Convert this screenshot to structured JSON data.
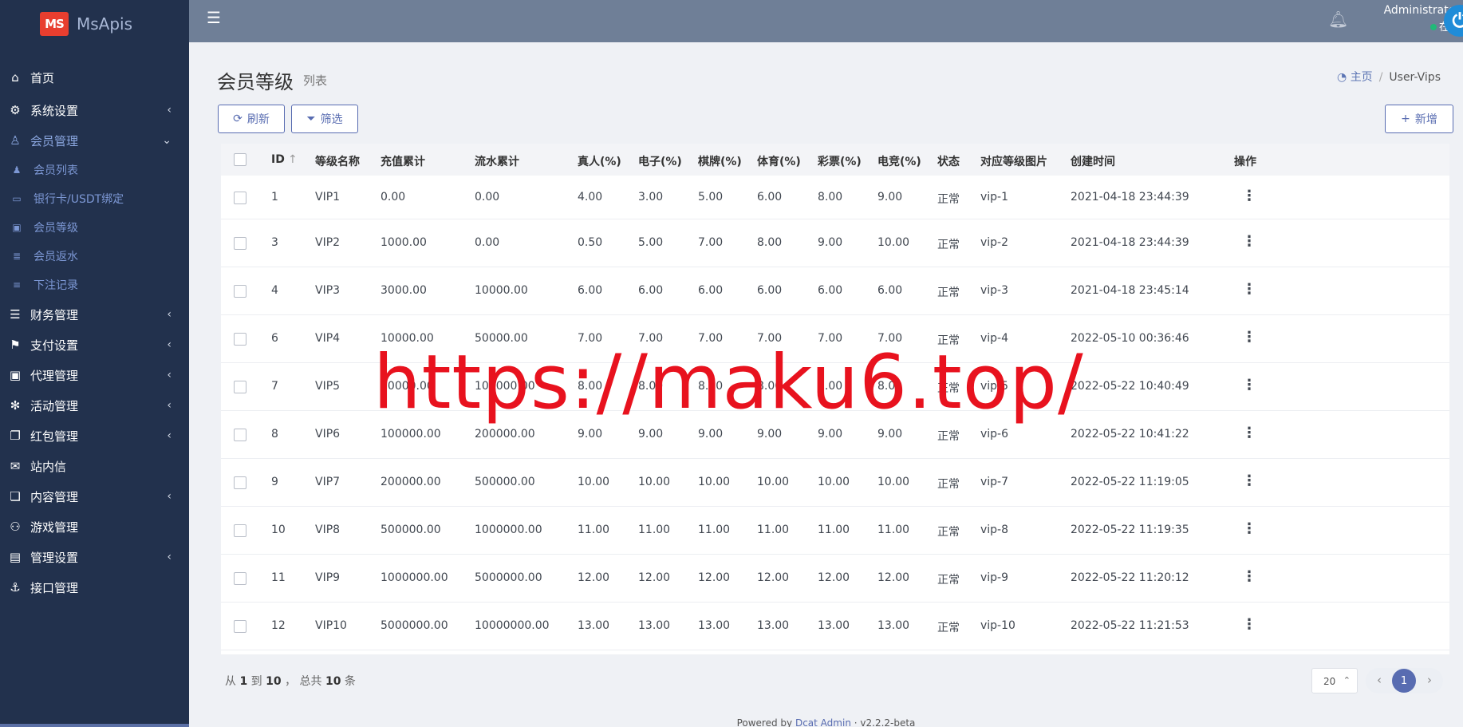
{
  "brand": {
    "logo_text": "MS",
    "name": "MsApis"
  },
  "sidebar": {
    "items": [
      {
        "icon": "home-icon",
        "glyph": "⌂",
        "label": "首页",
        "arrow": ""
      },
      {
        "icon": "gears-icon",
        "glyph": "⚙",
        "label": "系统设置",
        "arrow": "‹"
      },
      {
        "icon": "user-icon",
        "glyph": "♙",
        "label": "会员管理",
        "arrow": "⌄"
      },
      {
        "icon": "database-icon",
        "glyph": "☰",
        "label": "财务管理",
        "arrow": "‹"
      },
      {
        "icon": "bookmark-icon",
        "glyph": "⚑",
        "label": "支付设置",
        "arrow": "‹"
      },
      {
        "icon": "id-card-icon",
        "glyph": "▣",
        "label": "代理管理",
        "arrow": "‹"
      },
      {
        "icon": "asterisk-icon",
        "glyph": "✻",
        "label": "活动管理",
        "arrow": "‹"
      },
      {
        "icon": "clone-icon",
        "glyph": "❐",
        "label": "红包管理",
        "arrow": "‹"
      },
      {
        "icon": "envelope-icon",
        "glyph": "✉",
        "label": "站内信",
        "arrow": ""
      },
      {
        "icon": "copy-icon",
        "glyph": "❏",
        "label": "内容管理",
        "arrow": "‹"
      },
      {
        "icon": "gamepad-icon",
        "glyph": "⚇",
        "label": "游戏管理",
        "arrow": ""
      },
      {
        "icon": "address-card-icon",
        "glyph": "▤",
        "label": "管理设置",
        "arrow": "‹"
      },
      {
        "icon": "anchor-icon",
        "glyph": "⚓",
        "label": "接口管理",
        "arrow": ""
      }
    ],
    "sub_items": [
      {
        "icon": "user-icon",
        "glyph": "♟",
        "label": "会员列表"
      },
      {
        "icon": "credit-card-icon",
        "glyph": "▭",
        "label": "银行卡/USDT绑定"
      },
      {
        "icon": "portrait-icon",
        "glyph": "▣",
        "label": "会员等级"
      },
      {
        "icon": "list-icon",
        "glyph": "≣",
        "label": "会员返水"
      },
      {
        "icon": "stream-icon",
        "glyph": "≡",
        "label": "下注记录"
      }
    ]
  },
  "header": {
    "user_name": "Administrator",
    "user_status": "在线"
  },
  "page": {
    "title": "会员等级",
    "subtitle": "列表",
    "breadcrumb_home": "主页",
    "breadcrumb_current": "User-Vips"
  },
  "toolbar": {
    "refresh_label": "刷新",
    "filter_label": "筛选",
    "add_label": "新增"
  },
  "table": {
    "columns": [
      "ID",
      "等级名称",
      "充值累计",
      "流水累计",
      "真人(%)",
      "电子(%)",
      "棋牌(%)",
      "体育(%)",
      "彩票(%)",
      "电竞(%)",
      "状态",
      "对应等级图片",
      "创建时间",
      "操作"
    ],
    "rows": [
      [
        "1",
        "VIP1",
        "0.00",
        "0.00",
        "4.00",
        "3.00",
        "5.00",
        "6.00",
        "8.00",
        "9.00",
        "正常",
        "vip-1",
        "2021-04-18 23:44:39"
      ],
      [
        "3",
        "VIP2",
        "1000.00",
        "0.00",
        "0.50",
        "5.00",
        "7.00",
        "8.00",
        "9.00",
        "10.00",
        "正常",
        "vip-2",
        "2021-04-18 23:44:39"
      ],
      [
        "4",
        "VIP3",
        "3000.00",
        "10000.00",
        "6.00",
        "6.00",
        "6.00",
        "6.00",
        "6.00",
        "6.00",
        "正常",
        "vip-3",
        "2021-04-18 23:45:14"
      ],
      [
        "6",
        "VIP4",
        "10000.00",
        "50000.00",
        "7.00",
        "7.00",
        "7.00",
        "7.00",
        "7.00",
        "7.00",
        "正常",
        "vip-4",
        "2022-05-10 00:36:46"
      ],
      [
        "7",
        "VIP5",
        "50000.00",
        "100000.00",
        "8.00",
        "8.00",
        "8.00",
        "8.00",
        "8.00",
        "8.00",
        "正常",
        "vip-5",
        "2022-05-22 10:40:49"
      ],
      [
        "8",
        "VIP6",
        "100000.00",
        "200000.00",
        "9.00",
        "9.00",
        "9.00",
        "9.00",
        "9.00",
        "9.00",
        "正常",
        "vip-6",
        "2022-05-22 10:41:22"
      ],
      [
        "9",
        "VIP7",
        "200000.00",
        "500000.00",
        "10.00",
        "10.00",
        "10.00",
        "10.00",
        "10.00",
        "10.00",
        "正常",
        "vip-7",
        "2022-05-22 11:19:05"
      ],
      [
        "10",
        "VIP8",
        "500000.00",
        "1000000.00",
        "11.00",
        "11.00",
        "11.00",
        "11.00",
        "11.00",
        "11.00",
        "正常",
        "vip-8",
        "2022-05-22 11:19:35"
      ],
      [
        "11",
        "VIP9",
        "1000000.00",
        "5000000.00",
        "12.00",
        "12.00",
        "12.00",
        "12.00",
        "12.00",
        "12.00",
        "正常",
        "vip-9",
        "2022-05-22 11:20:12"
      ],
      [
        "12",
        "VIP10",
        "5000000.00",
        "10000000.00",
        "13.00",
        "13.00",
        "13.00",
        "13.00",
        "13.00",
        "13.00",
        "正常",
        "vip-10",
        "2022-05-22 11:21:53"
      ]
    ]
  },
  "pagination": {
    "summary_from": "1",
    "summary_to": "10",
    "summary_total": "10",
    "per_page": "20",
    "current_page": "1"
  },
  "footer": {
    "powered_by": "Powered by",
    "link": "Dcat Admin",
    "version": "v2.2.2-beta"
  },
  "watermark": "https://maku6.top/",
  "colors": {
    "sidebar_bg": "#22314d",
    "topbar_bg": "#6f7f97",
    "accent": "#586cb1",
    "watermark": "#e8121e",
    "online": "#21b978"
  }
}
